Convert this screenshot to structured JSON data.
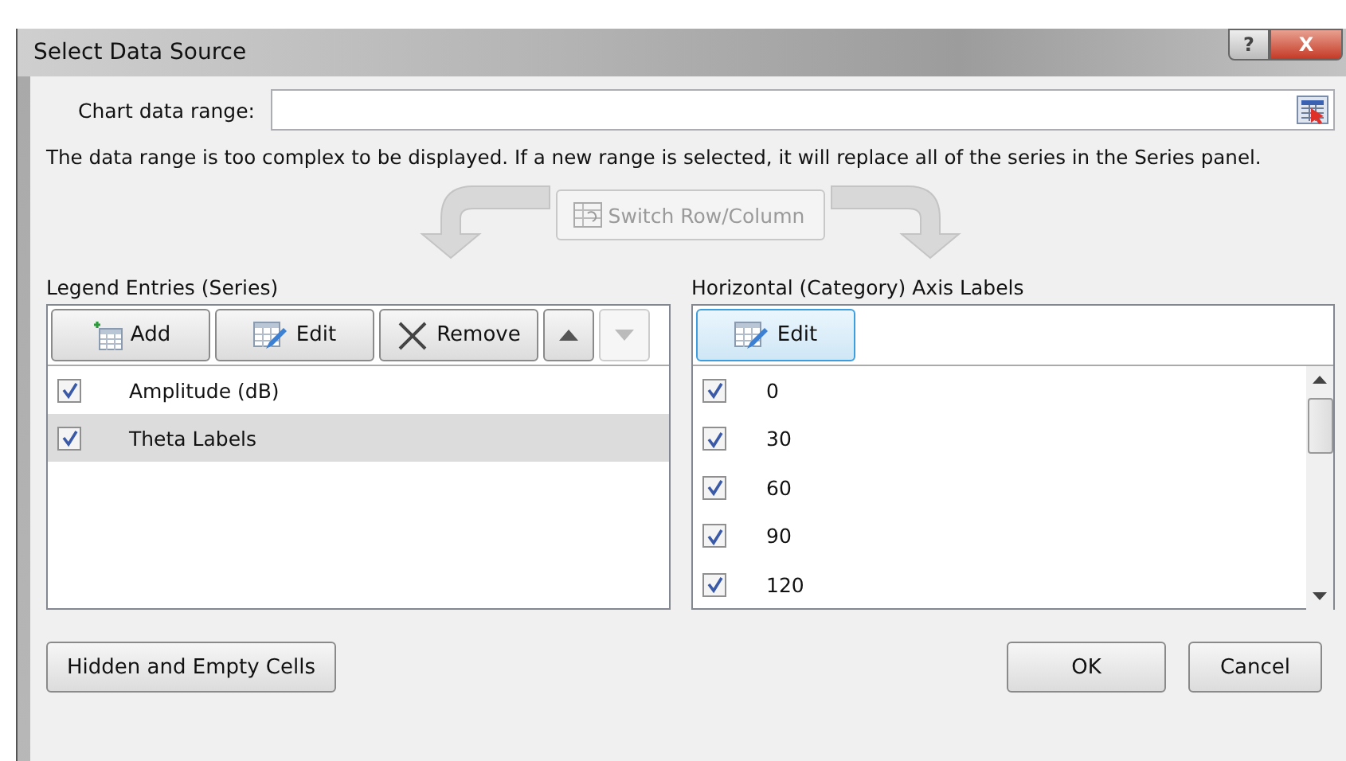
{
  "window": {
    "title": "Select Data Source",
    "help": "?",
    "close": "X"
  },
  "chart_data_range": {
    "label": "Chart data range:"
  },
  "message": "The data range is too complex to be displayed. If a new range is selected, it will replace all of the series in the Series panel.",
  "switch_button": {
    "label": "Switch Row/Column",
    "disabled": true
  },
  "legend": {
    "title": "Legend Entries (Series)",
    "toolbar": [
      {
        "kind": "add",
        "label": "Add",
        "disabled": false
      },
      {
        "kind": "edit",
        "label": "Edit",
        "disabled": false
      },
      {
        "kind": "remove",
        "label": "Remove",
        "disabled": false
      },
      {
        "kind": "up",
        "disabled": false
      },
      {
        "kind": "down",
        "disabled": true
      }
    ],
    "items": [
      {
        "label": "Amplitude (dB)",
        "checked": true,
        "selected": false
      },
      {
        "label": "Theta Labels",
        "checked": true,
        "selected": true
      }
    ]
  },
  "axis": {
    "title": "Horizontal (Category) Axis Labels",
    "edit": {
      "label": "Edit"
    },
    "items": [
      {
        "label": "0",
        "checked": true
      },
      {
        "label": "30",
        "checked": true
      },
      {
        "label": "60",
        "checked": true
      },
      {
        "label": "90",
        "checked": true
      },
      {
        "label": "120",
        "checked": true
      }
    ]
  },
  "buttons": {
    "hidden": "Hidden and Empty Cells",
    "ok": "OK",
    "cancel": "Cancel"
  }
}
